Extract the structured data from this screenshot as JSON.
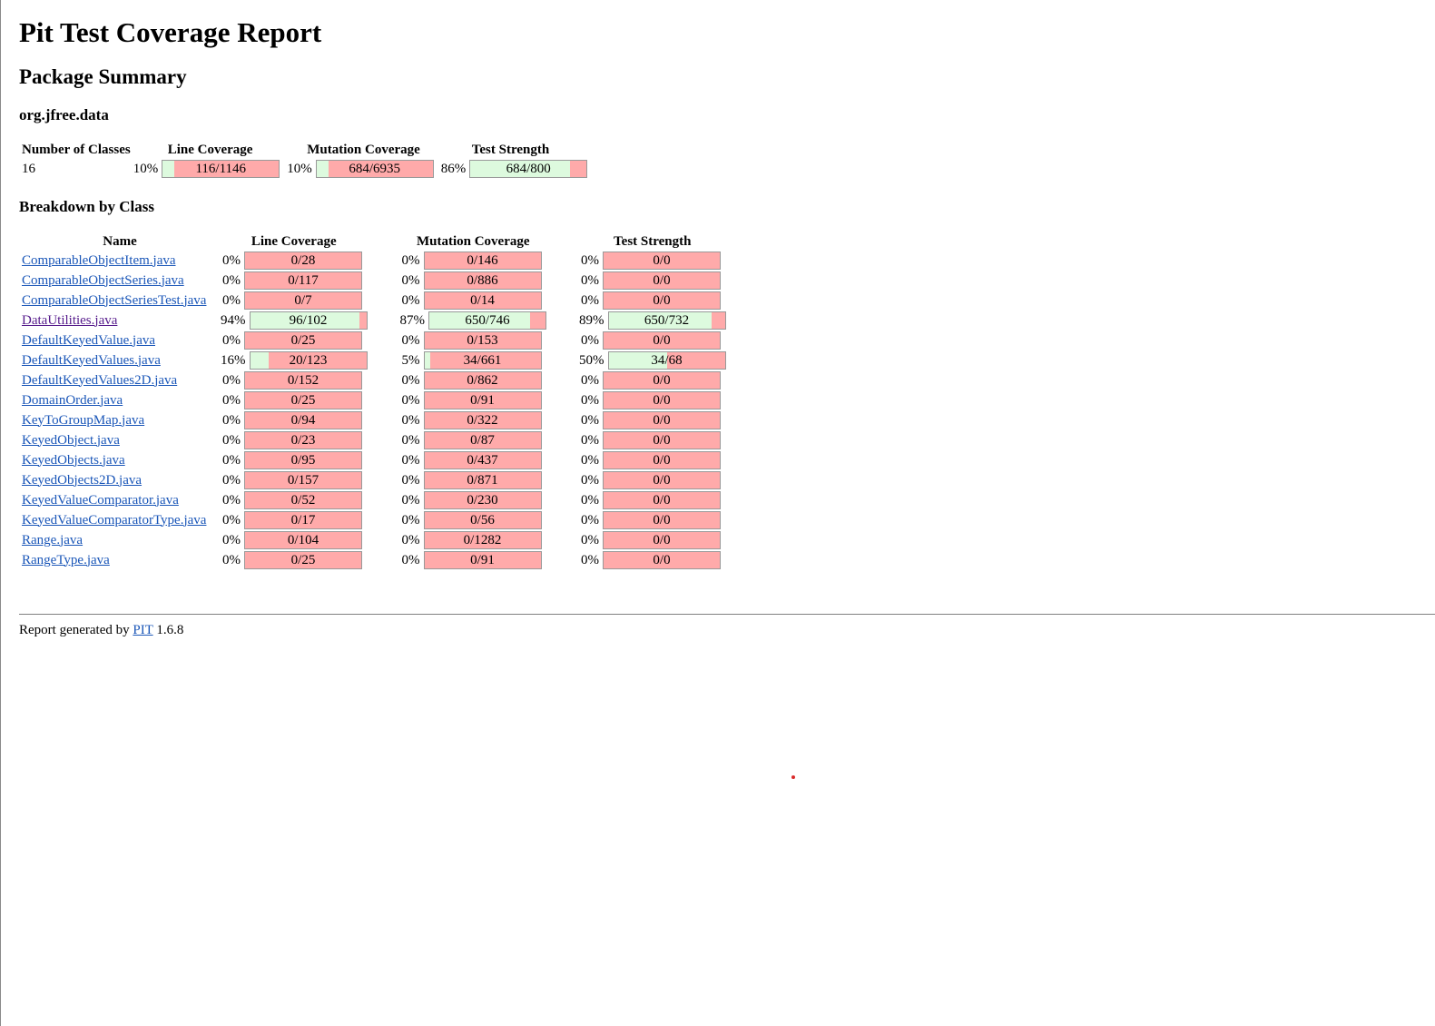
{
  "page_title": "Pit Test Coverage Report",
  "section_title": "Package Summary",
  "package_name": "org.jfree.data",
  "summary": {
    "headers": [
      "Number of Classes",
      "Line Coverage",
      "Mutation Coverage",
      "Test Strength"
    ],
    "number_of_classes": "16",
    "line": {
      "pct": "10%",
      "text": "116/1146",
      "fraction": 0.1
    },
    "mutation": {
      "pct": "10%",
      "text": "684/6935",
      "fraction": 0.1
    },
    "strength": {
      "pct": "86%",
      "text": "684/800",
      "fraction": 0.86
    }
  },
  "breakdown_title": "Breakdown by Class",
  "breakdown_headers": [
    "Name",
    "Line Coverage",
    "Mutation Coverage",
    "Test Strength"
  ],
  "classes": [
    {
      "name": "ComparableObjectItem.java",
      "line_pct": "0%",
      "line": "0/28",
      "line_f": 0,
      "mut_pct": "0%",
      "mut": "0/146",
      "mut_f": 0,
      "ts_pct": "0%",
      "ts": "0/0",
      "ts_f": 0
    },
    {
      "name": "ComparableObjectSeries.java",
      "line_pct": "0%",
      "line": "0/117",
      "line_f": 0,
      "mut_pct": "0%",
      "mut": "0/886",
      "mut_f": 0,
      "ts_pct": "0%",
      "ts": "0/0",
      "ts_f": 0
    },
    {
      "name": "ComparableObjectSeriesTest.java",
      "line_pct": "0%",
      "line": "0/7",
      "line_f": 0,
      "mut_pct": "0%",
      "mut": "0/14",
      "mut_f": 0,
      "ts_pct": "0%",
      "ts": "0/0",
      "ts_f": 0
    },
    {
      "name": "DataUtilities.java",
      "visited": true,
      "line_pct": "94%",
      "line": "96/102",
      "line_f": 0.94,
      "mut_pct": "87%",
      "mut": "650/746",
      "mut_f": 0.87,
      "ts_pct": "89%",
      "ts": "650/732",
      "ts_f": 0.89
    },
    {
      "name": "DefaultKeyedValue.java",
      "line_pct": "0%",
      "line": "0/25",
      "line_f": 0,
      "mut_pct": "0%",
      "mut": "0/153",
      "mut_f": 0,
      "ts_pct": "0%",
      "ts": "0/0",
      "ts_f": 0
    },
    {
      "name": "DefaultKeyedValues.java",
      "line_pct": "16%",
      "line": "20/123",
      "line_f": 0.16,
      "mut_pct": "5%",
      "mut": "34/661",
      "mut_f": 0.05,
      "ts_pct": "50%",
      "ts": "34/68",
      "ts_f": 0.5
    },
    {
      "name": "DefaultKeyedValues2D.java",
      "line_pct": "0%",
      "line": "0/152",
      "line_f": 0,
      "mut_pct": "0%",
      "mut": "0/862",
      "mut_f": 0,
      "ts_pct": "0%",
      "ts": "0/0",
      "ts_f": 0
    },
    {
      "name": "DomainOrder.java",
      "line_pct": "0%",
      "line": "0/25",
      "line_f": 0,
      "mut_pct": "0%",
      "mut": "0/91",
      "mut_f": 0,
      "ts_pct": "0%",
      "ts": "0/0",
      "ts_f": 0
    },
    {
      "name": "KeyToGroupMap.java",
      "line_pct": "0%",
      "line": "0/94",
      "line_f": 0,
      "mut_pct": "0%",
      "mut": "0/322",
      "mut_f": 0,
      "ts_pct": "0%",
      "ts": "0/0",
      "ts_f": 0
    },
    {
      "name": "KeyedObject.java",
      "line_pct": "0%",
      "line": "0/23",
      "line_f": 0,
      "mut_pct": "0%",
      "mut": "0/87",
      "mut_f": 0,
      "ts_pct": "0%",
      "ts": "0/0",
      "ts_f": 0
    },
    {
      "name": "KeyedObjects.java",
      "line_pct": "0%",
      "line": "0/95",
      "line_f": 0,
      "mut_pct": "0%",
      "mut": "0/437",
      "mut_f": 0,
      "ts_pct": "0%",
      "ts": "0/0",
      "ts_f": 0
    },
    {
      "name": "KeyedObjects2D.java",
      "line_pct": "0%",
      "line": "0/157",
      "line_f": 0,
      "mut_pct": "0%",
      "mut": "0/871",
      "mut_f": 0,
      "ts_pct": "0%",
      "ts": "0/0",
      "ts_f": 0
    },
    {
      "name": "KeyedValueComparator.java",
      "line_pct": "0%",
      "line": "0/52",
      "line_f": 0,
      "mut_pct": "0%",
      "mut": "0/230",
      "mut_f": 0,
      "ts_pct": "0%",
      "ts": "0/0",
      "ts_f": 0
    },
    {
      "name": "KeyedValueComparatorType.java",
      "line_pct": "0%",
      "line": "0/17",
      "line_f": 0,
      "mut_pct": "0%",
      "mut": "0/56",
      "mut_f": 0,
      "ts_pct": "0%",
      "ts": "0/0",
      "ts_f": 0
    },
    {
      "name": "Range.java",
      "line_pct": "0%",
      "line": "0/104",
      "line_f": 0,
      "mut_pct": "0%",
      "mut": "0/1282",
      "mut_f": 0,
      "ts_pct": "0%",
      "ts": "0/0",
      "ts_f": 0
    },
    {
      "name": "RangeType.java",
      "line_pct": "0%",
      "line": "0/25",
      "line_f": 0,
      "mut_pct": "0%",
      "mut": "0/91",
      "mut_f": 0,
      "ts_pct": "0%",
      "ts": "0/0",
      "ts_f": 0
    }
  ],
  "footer": {
    "prefix": "Report generated by ",
    "link": "PIT",
    "version": " 1.6.8"
  },
  "colors": {
    "covered": "#ddfade",
    "uncovered": "#ffaaaa",
    "link": "#1a56b8",
    "visited": "#551a8b"
  }
}
